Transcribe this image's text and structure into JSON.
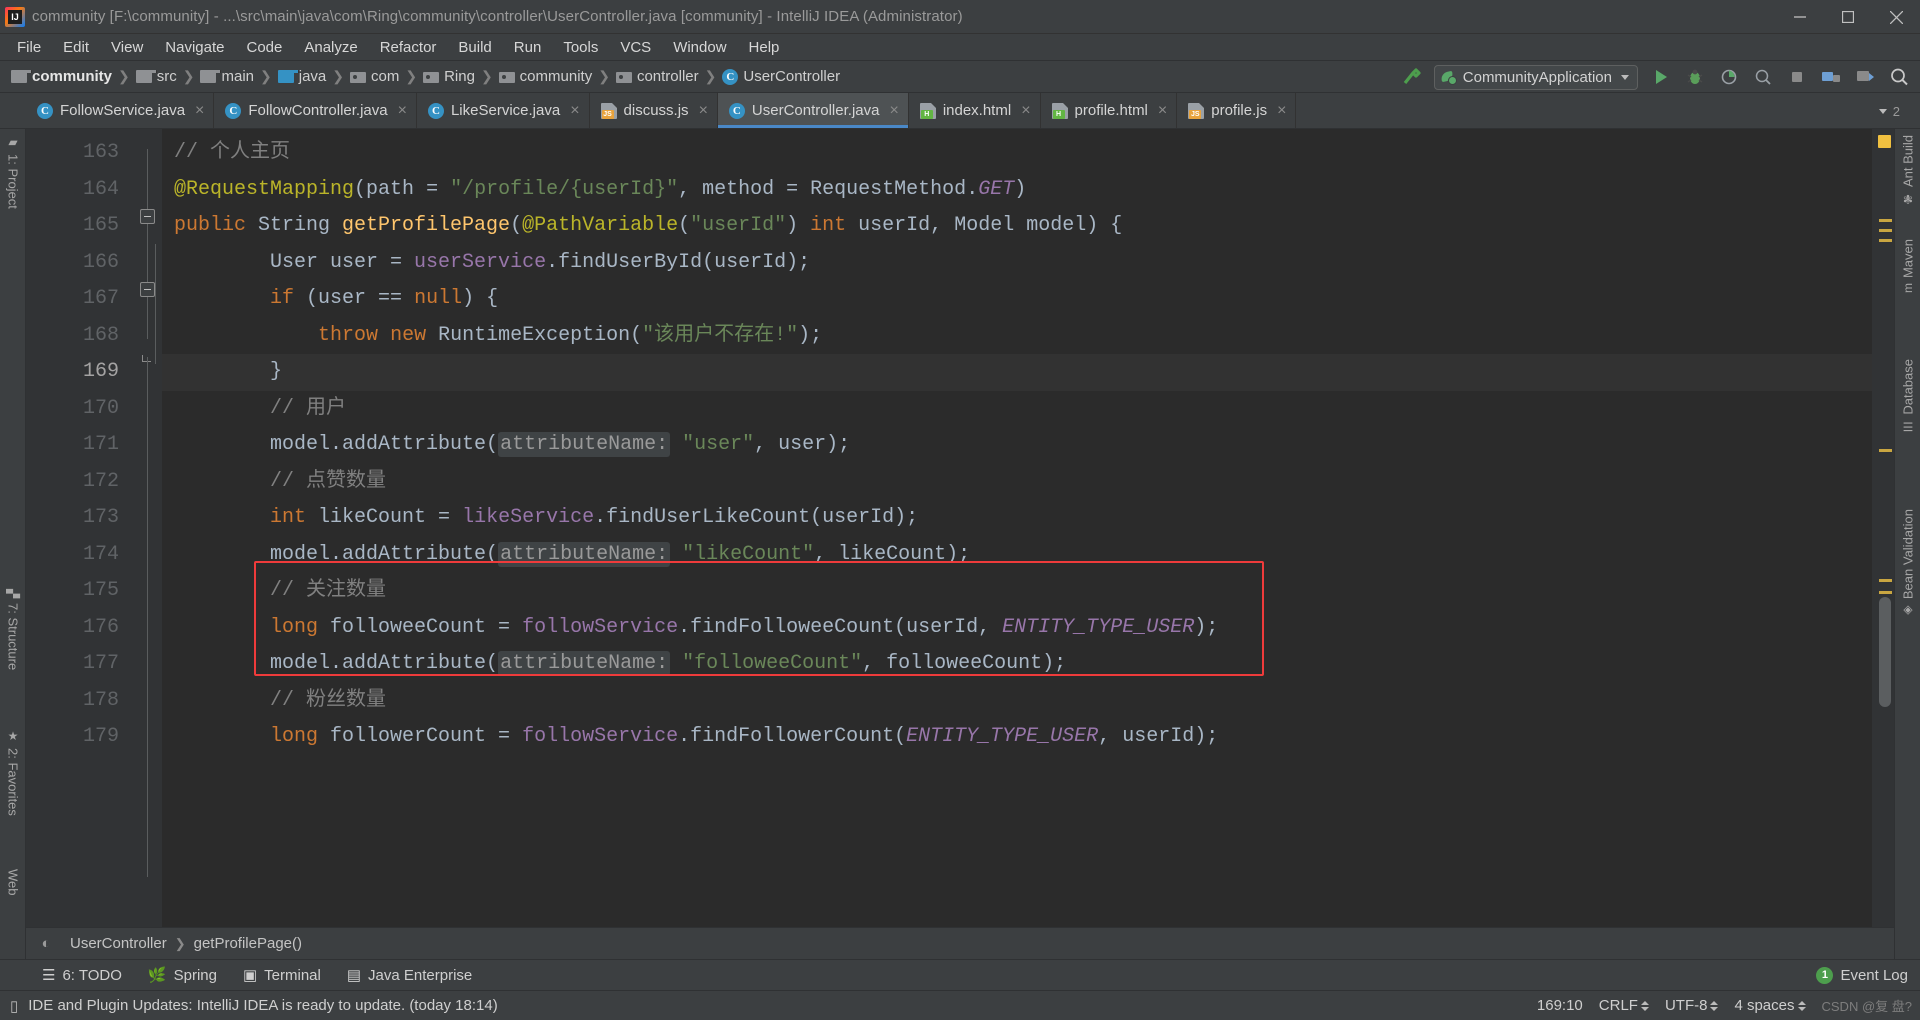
{
  "window": {
    "title": "community [F:\\community] - ...\\src\\main\\java\\com\\Ring\\community\\controller\\UserController.java [community] - IntelliJ IDEA (Administrator)",
    "minimize_label": "Minimize",
    "maximize_label": "Maximize",
    "close_label": "Close",
    "app_icon": "intellij-idea-icon"
  },
  "menubar": {
    "items": [
      {
        "label": "File"
      },
      {
        "label": "Edit"
      },
      {
        "label": "View"
      },
      {
        "label": "Navigate"
      },
      {
        "label": "Code"
      },
      {
        "label": "Analyze"
      },
      {
        "label": "Refactor"
      },
      {
        "label": "Build"
      },
      {
        "label": "Run"
      },
      {
        "label": "Tools"
      },
      {
        "label": "VCS"
      },
      {
        "label": "Window"
      },
      {
        "label": "Help"
      }
    ]
  },
  "navbar": {
    "breadcrumbs": [
      {
        "label": "community",
        "icon": "folder-icon",
        "kind": "module",
        "bold": true
      },
      {
        "label": "src",
        "icon": "folder-icon",
        "kind": "folder",
        "bold": false
      },
      {
        "label": "main",
        "icon": "folder-icon",
        "kind": "folder",
        "bold": false
      },
      {
        "label": "java",
        "icon": "folder-source-icon",
        "kind": "source",
        "bold": false
      },
      {
        "label": "com",
        "icon": "package-icon",
        "kind": "package",
        "bold": false
      },
      {
        "label": "Ring",
        "icon": "package-icon",
        "kind": "package",
        "bold": false
      },
      {
        "label": "community",
        "icon": "package-icon",
        "kind": "package",
        "bold": false
      },
      {
        "label": "controller",
        "icon": "package-icon",
        "kind": "package",
        "bold": false
      },
      {
        "label": "UserController",
        "icon": "class-icon",
        "kind": "class",
        "bold": false
      }
    ],
    "separator": "❯",
    "run_config": {
      "label": "CommunityApplication",
      "icon": "spring-boot-icon",
      "dropdown_icon": "chevron-down-icon"
    },
    "actions": [
      {
        "name": "make-project-button",
        "icon": "hammer-icon"
      },
      {
        "name": "run-button",
        "icon": "play-icon"
      },
      {
        "name": "debug-button",
        "icon": "debug-icon"
      },
      {
        "name": "run-with-coverage-button",
        "icon": "coverage-icon"
      },
      {
        "name": "profile-button",
        "icon": "profiler-icon"
      },
      {
        "name": "stop-button",
        "icon": "stop-icon"
      },
      {
        "name": "update-project-button",
        "icon": "vcs-update-icon"
      },
      {
        "name": "commit-button",
        "icon": "vcs-commit-icon"
      },
      {
        "name": "search-everywhere-button",
        "icon": "search-icon"
      }
    ]
  },
  "tabs": {
    "overflow_count": "2",
    "items": [
      {
        "label": "FollowService.java",
        "icon": "java-class-icon",
        "active": false,
        "close": "×"
      },
      {
        "label": "FollowController.java",
        "icon": "java-class-icon",
        "active": false,
        "close": "×"
      },
      {
        "label": "LikeService.java",
        "icon": "java-class-icon",
        "active": false,
        "close": "×"
      },
      {
        "label": "discuss.js",
        "icon": "javascript-file-icon",
        "active": false,
        "close": "×"
      },
      {
        "label": "UserController.java",
        "icon": "java-class-icon",
        "active": true,
        "close": "×"
      },
      {
        "label": "index.html",
        "icon": "html-file-icon",
        "active": false,
        "close": "×"
      },
      {
        "label": "profile.html",
        "icon": "html-file-icon",
        "active": false,
        "close": "×"
      },
      {
        "label": "profile.js",
        "icon": "javascript-file-icon",
        "active": false,
        "close": "×"
      }
    ]
  },
  "left_toolwindows": [
    {
      "label": "1: Project",
      "shortcut": "1",
      "icon": "project-folder-icon"
    },
    {
      "label": "7: Structure",
      "shortcut": "7",
      "icon": "structure-icon"
    },
    {
      "label": "2: Favorites",
      "shortcut": "2",
      "icon": "star-icon"
    },
    {
      "label": "Web",
      "shortcut": "",
      "icon": "web-icon"
    }
  ],
  "right_toolwindows": [
    {
      "label": "Ant Build",
      "icon": "ant-icon"
    },
    {
      "label": "Maven",
      "icon": "maven-icon"
    },
    {
      "label": "Database",
      "icon": "database-icon"
    },
    {
      "label": "Bean Validation",
      "icon": "bean-validation-icon"
    }
  ],
  "editor": {
    "first_line": 163,
    "caret_line": 169,
    "lines": [
      {
        "num": "163",
        "indent": 1,
        "tokens": [
          {
            "t": "    ",
            "c": "plain"
          },
          {
            "t": "// 个人主页",
            "c": "comment"
          }
        ]
      },
      {
        "num": "164",
        "indent": 1,
        "tokens": [
          {
            "t": "    ",
            "c": "plain"
          },
          {
            "t": "@RequestMapping",
            "c": "anno"
          },
          {
            "t": "(",
            "c": "plain"
          },
          {
            "t": "path",
            "c": "plain"
          },
          {
            "t": " = ",
            "c": "plain"
          },
          {
            "t": "\"/profile/{userId}\"",
            "c": "str"
          },
          {
            "t": ", ",
            "c": "plain"
          },
          {
            "t": "method",
            "c": "plain"
          },
          {
            "t": " = RequestMethod.",
            "c": "plain"
          },
          {
            "t": "GET",
            "c": "static"
          },
          {
            "t": ")",
            "c": "plain"
          }
        ]
      },
      {
        "num": "165",
        "indent": 1,
        "tokens": [
          {
            "t": "    ",
            "c": "plain"
          },
          {
            "t": "public",
            "c": "kw"
          },
          {
            "t": " String ",
            "c": "plain"
          },
          {
            "t": "getProfilePage",
            "c": "method"
          },
          {
            "t": "(",
            "c": "plain"
          },
          {
            "t": "@PathVariable",
            "c": "anno"
          },
          {
            "t": "(",
            "c": "plain"
          },
          {
            "t": "\"userId\"",
            "c": "str"
          },
          {
            "t": ") ",
            "c": "plain"
          },
          {
            "t": "int",
            "c": "kw"
          },
          {
            "t": " userId, Model model) {",
            "c": "plain"
          }
        ]
      },
      {
        "num": "166",
        "indent": 2,
        "tokens": [
          {
            "t": "        User user = ",
            "c": "plain"
          },
          {
            "t": "userService",
            "c": "field"
          },
          {
            "t": ".findUserById(userId);",
            "c": "plain"
          }
        ]
      },
      {
        "num": "167",
        "indent": 2,
        "tokens": [
          {
            "t": "        ",
            "c": "plain"
          },
          {
            "t": "if",
            "c": "kw"
          },
          {
            "t": " (user == ",
            "c": "plain"
          },
          {
            "t": "null",
            "c": "kw"
          },
          {
            "t": ") {",
            "c": "plain"
          }
        ]
      },
      {
        "num": "168",
        "indent": 3,
        "tokens": [
          {
            "t": "            ",
            "c": "plain"
          },
          {
            "t": "throw",
            "c": "kw"
          },
          {
            "t": " ",
            "c": "plain"
          },
          {
            "t": "new",
            "c": "kw"
          },
          {
            "t": " RuntimeException(",
            "c": "plain"
          },
          {
            "t": "\"该用户不存在!\"",
            "c": "str"
          },
          {
            "t": ");",
            "c": "plain"
          }
        ]
      },
      {
        "num": "169",
        "indent": 2,
        "tokens": [
          {
            "t": "        }",
            "c": "plain"
          }
        ]
      },
      {
        "num": "170",
        "indent": 2,
        "tokens": [
          {
            "t": "        ",
            "c": "plain"
          },
          {
            "t": "// 用户",
            "c": "comment"
          }
        ]
      },
      {
        "num": "171",
        "indent": 2,
        "tokens": [
          {
            "t": "        model.addAttribute(",
            "c": "plain"
          },
          {
            "t": "attributeName:",
            "c": "param"
          },
          {
            "t": " ",
            "c": "plain"
          },
          {
            "t": "\"user\"",
            "c": "str"
          },
          {
            "t": ", user);",
            "c": "plain"
          }
        ]
      },
      {
        "num": "172",
        "indent": 2,
        "tokens": [
          {
            "t": "        ",
            "c": "plain"
          },
          {
            "t": "// 点赞数量",
            "c": "comment"
          }
        ]
      },
      {
        "num": "173",
        "indent": 2,
        "tokens": [
          {
            "t": "        ",
            "c": "plain"
          },
          {
            "t": "int",
            "c": "kw"
          },
          {
            "t": " likeCount = ",
            "c": "plain"
          },
          {
            "t": "likeService",
            "c": "field"
          },
          {
            "t": ".findUserLikeCount(userId);",
            "c": "plain"
          }
        ]
      },
      {
        "num": "174",
        "indent": 2,
        "tokens": [
          {
            "t": "        model.addAttribute(",
            "c": "plain"
          },
          {
            "t": "attributeName:",
            "c": "param"
          },
          {
            "t": " ",
            "c": "plain"
          },
          {
            "t": "\"likeCount\"",
            "c": "str"
          },
          {
            "t": ", likeCount);",
            "c": "plain"
          }
        ]
      },
      {
        "num": "175",
        "indent": 2,
        "tokens": [
          {
            "t": "        ",
            "c": "plain"
          },
          {
            "t": "// 关注数量",
            "c": "comment"
          }
        ]
      },
      {
        "num": "176",
        "indent": 2,
        "tokens": [
          {
            "t": "        ",
            "c": "plain"
          },
          {
            "t": "long",
            "c": "kw"
          },
          {
            "t": " followeeCount = ",
            "c": "plain"
          },
          {
            "t": "followService",
            "c": "field"
          },
          {
            "t": ".findFolloweeCount(userId, ",
            "c": "plain"
          },
          {
            "t": "ENTITY_TYPE_USER",
            "c": "static"
          },
          {
            "t": ");",
            "c": "plain"
          }
        ]
      },
      {
        "num": "177",
        "indent": 2,
        "tokens": [
          {
            "t": "        model.addAttribute(",
            "c": "plain"
          },
          {
            "t": "attributeName:",
            "c": "param"
          },
          {
            "t": " ",
            "c": "plain"
          },
          {
            "t": "\"followeeCount\"",
            "c": "str"
          },
          {
            "t": ", followeeCount);",
            "c": "plain"
          }
        ]
      },
      {
        "num": "178",
        "indent": 2,
        "tokens": [
          {
            "t": "        ",
            "c": "plain"
          },
          {
            "t": "// 粉丝数量",
            "c": "comment"
          }
        ]
      },
      {
        "num": "179",
        "indent": 2,
        "tokens": [
          {
            "t": "        ",
            "c": "plain"
          },
          {
            "t": "long",
            "c": "kw"
          },
          {
            "t": " followerCount = ",
            "c": "plain"
          },
          {
            "t": "followService",
            "c": "field"
          },
          {
            "t": ".findFollowerCount(",
            "c": "plain"
          },
          {
            "t": "ENTITY_TYPE_USER",
            "c": "static"
          },
          {
            "t": ", userId);",
            "c": "plain"
          }
        ]
      }
    ],
    "highlight_box": {
      "color": "#ef3b3b",
      "from_line": "175",
      "to_line": "177"
    },
    "breadcrumb": {
      "class": "UserController",
      "method": "getProfilePage()",
      "separator": "❯",
      "icon": "web-globe-icon"
    }
  },
  "bottom_toolwindows": [
    {
      "label": "6: TODO",
      "shortcut": "6",
      "icon": "todo-list-icon"
    },
    {
      "label": "Spring",
      "shortcut": "",
      "icon": "spring-leaf-icon"
    },
    {
      "label": "Terminal",
      "shortcut": "",
      "icon": "terminal-icon"
    },
    {
      "label": "Java Enterprise",
      "shortcut": "",
      "icon": "java-enterprise-icon"
    }
  ],
  "event_log": {
    "count": "1",
    "label": "Event Log"
  },
  "statusbar": {
    "message": "IDE and Plugin Updates: IntelliJ IDEA is ready to update. (today 18:14)",
    "message_icon": "notification-icon",
    "caret_position": "169:10",
    "line_separator": "CRLF",
    "encoding": "UTF-8",
    "indent": "4 spaces",
    "watermark": "CSDN @复 盘?"
  },
  "colors": {
    "accent_blue": "#4a88c7",
    "tab_active_bg": "#4e5254",
    "editor_bg": "#2b2b2b",
    "gutter_bg": "#313335",
    "chrome_bg": "#3c3f41",
    "highlight_red": "#ef3b3b",
    "keyword": "#cc7832",
    "string": "#6a8759",
    "comment": "#808080",
    "annotation": "#bbb529",
    "field": "#9876aa",
    "method": "#ffc66d",
    "plain_text": "#a9b7c6"
  }
}
